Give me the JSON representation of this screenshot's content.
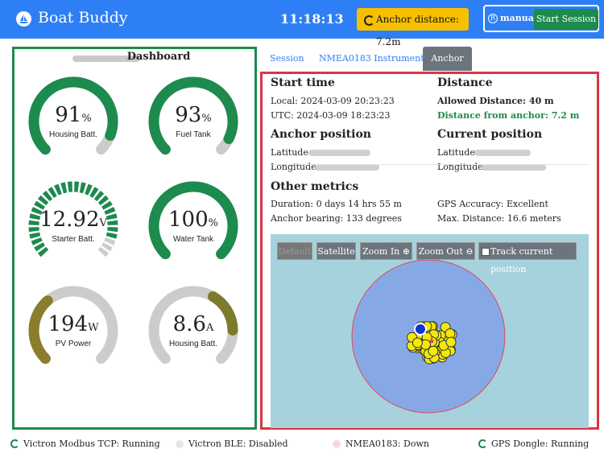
{
  "header": {
    "app_title": "Boat Buddy",
    "clock": "11:18:13",
    "anchor_badge": "Anchor distance: 7.2m",
    "mode_icon": "R",
    "mode": "manual",
    "start_button": "Start Session"
  },
  "dashboard": {
    "title": "Dashboard",
    "gauges": [
      {
        "value": "91",
        "unit": "%",
        "label": "Housing Batt.",
        "fill": 0.91,
        "color": "#1d8a4e",
        "style": "solid"
      },
      {
        "value": "93",
        "unit": "%",
        "label": "Fuel Tank",
        "fill": 0.93,
        "color": "#1d8a4e",
        "style": "solid"
      },
      {
        "value": "12.92",
        "unit": "V",
        "label": "Starter Batt.",
        "fill": 0.9,
        "color": "#1d8a4e",
        "style": "segmented"
      },
      {
        "value": "100",
        "unit": "%",
        "label": "Water Tank",
        "fill": 1.0,
        "color": "#1d8a4e",
        "style": "solid"
      },
      {
        "value": "194",
        "unit": "W",
        "label": "PV Power",
        "fill": 0.35,
        "color": "#8a7d2b",
        "style": "solid"
      },
      {
        "value": "8.6",
        "unit": "A",
        "label": "Housing Batt.",
        "fill": 0.22,
        "color": "#7e7a2c",
        "style": "solid_right"
      }
    ]
  },
  "tabs": [
    {
      "label": "Session"
    },
    {
      "label": "NMEA0183 Instruments"
    },
    {
      "label": "Anchor"
    }
  ],
  "anchor": {
    "start_time_heading": "Start time",
    "local": "Local: 2024-03-09 20:23:23",
    "utc": "UTC: 2024-03-09 18:23:23",
    "distance_heading": "Distance",
    "allowed_distance": "Allowed Distance: 40 m",
    "distance_from_anchor": "Distance from anchor: 7.2 m",
    "anchor_position_heading": "Anchor position",
    "anchor_latitude_label": "Latitude: ",
    "anchor_longitude_label": "Longitude: ",
    "current_position_heading": "Current position",
    "current_latitude_label": "Latitude: ",
    "current_longitude_label": "Longitude: ",
    "other_metrics_heading": "Other metrics",
    "duration": "Duration: 0 days 14 hrs 55 m",
    "anchor_bearing": "Anchor bearing: 133 degrees",
    "gps_accuracy": "GPS Accuracy: Excellent",
    "max_distance": "Max. Distance: 16.6 meters"
  },
  "map": {
    "btn_default": "Default",
    "btn_satellite": "Satellite",
    "btn_zoom_in": "Zoom In",
    "btn_zoom_out": "Zoom Out",
    "track_label": "Track current position"
  },
  "status": [
    {
      "label": "Victron Modbus TCP: Running",
      "state": "running"
    },
    {
      "label": "Victron BLE: Disabled",
      "state": "disabled"
    },
    {
      "label": "NMEA0183: Down",
      "state": "down"
    },
    {
      "label": "GPS Dongle: Running",
      "state": "running"
    }
  ]
}
